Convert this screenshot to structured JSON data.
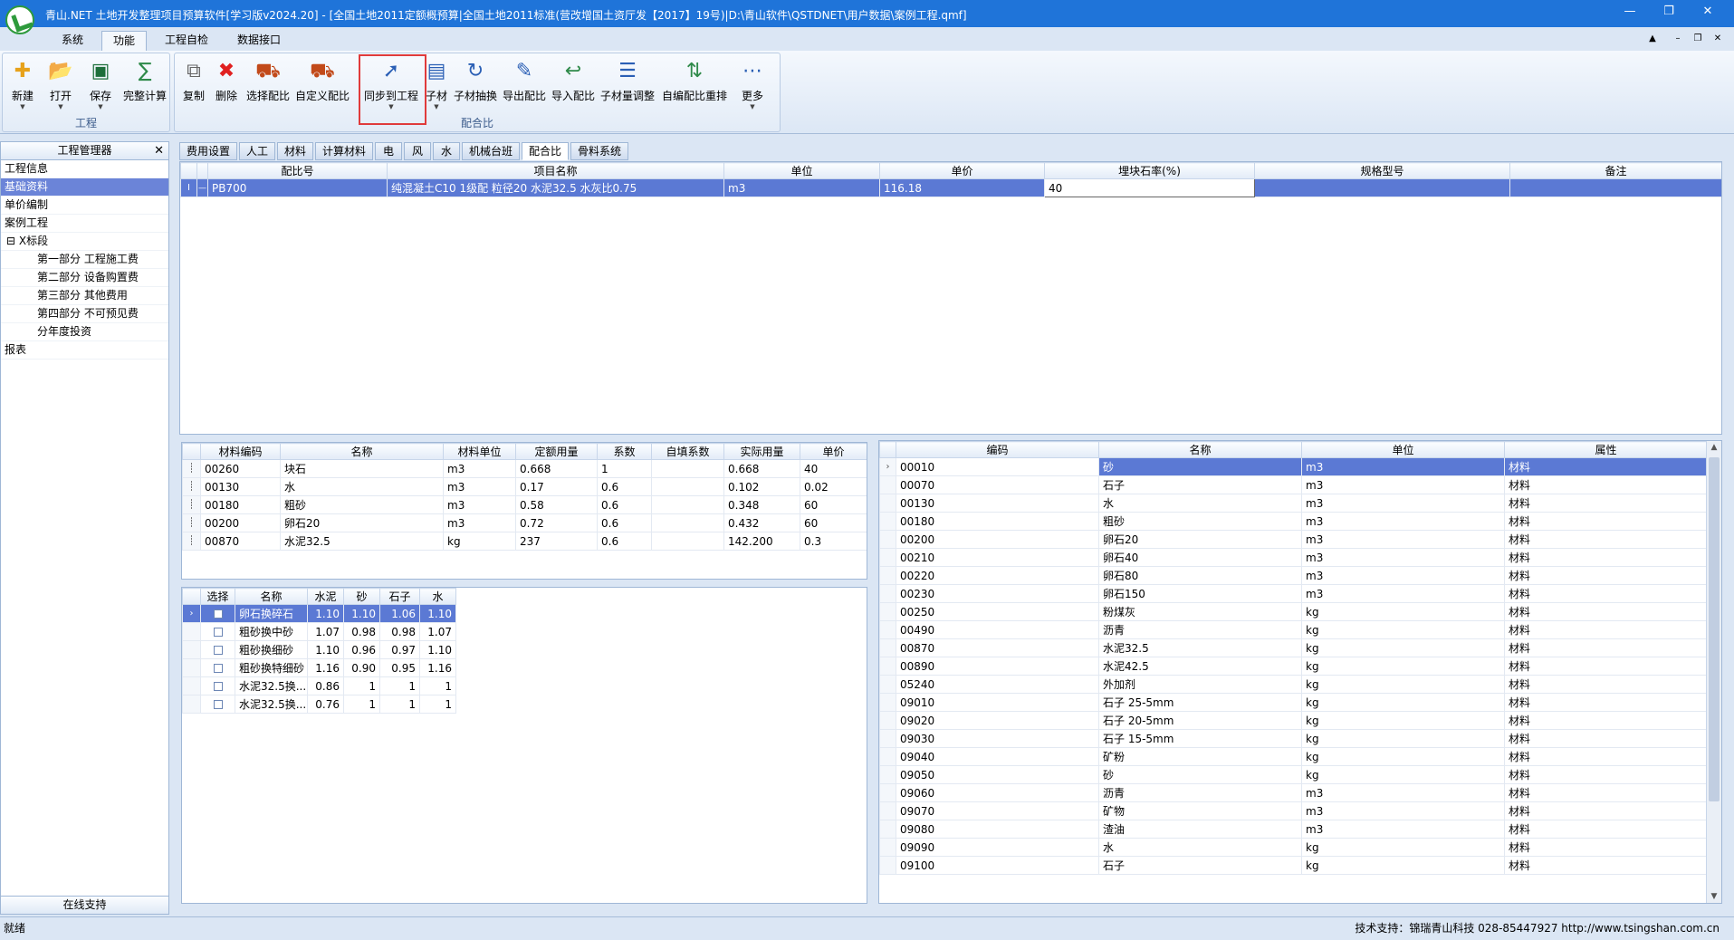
{
  "title": "青山.NET 土地开发整理项目预算软件[学习版v2024.20] - [全国土地2011定额概预算|全国土地2011标准(营改增国土资厅发【2017】19号)|D:\\青山软件\\QSTDNET\\用户数据\\案例工程.qmf]",
  "menu": [
    "系统",
    "功能",
    "工程自检",
    "数据接口"
  ],
  "ribbon": {
    "group1_label": "工程",
    "group2_label": "配合比",
    "buttons1": [
      {
        "label": "新建",
        "icon": "new-icon"
      },
      {
        "label": "打开",
        "icon": "folder-open-icon"
      },
      {
        "label": "保存",
        "icon": "save-icon"
      },
      {
        "label": "完整计算",
        "icon": "calculate-icon"
      }
    ],
    "buttons2": [
      {
        "label": "复制",
        "icon": "copy-icon"
      },
      {
        "label": "删除",
        "icon": "delete-icon"
      },
      {
        "label": "选择配比",
        "icon": "mixer-truck-icon"
      },
      {
        "label": "自定义配比",
        "icon": "mixer-truck-icon"
      },
      {
        "label": "同步到工程",
        "icon": "sync-icon"
      },
      {
        "label": "子材",
        "icon": "submaterial-icon"
      },
      {
        "label": "子材抽换",
        "icon": "swap-icon"
      },
      {
        "label": "导出配比",
        "icon": "export-icon"
      },
      {
        "label": "导入配比",
        "icon": "import-icon"
      },
      {
        "label": "子材量调整",
        "icon": "edit-list-icon"
      },
      {
        "label": "自编配比重排",
        "icon": "reorder-icon"
      },
      {
        "label": "更多",
        "icon": "more-icon"
      }
    ]
  },
  "left_panel": {
    "title": "工程管理器",
    "items": [
      "工程信息",
      "基础资料",
      "单价编制",
      "案例工程",
      "X标段",
      "第一部分 工程施工费",
      "第二部分 设备购置费",
      "第三部分 其他费用",
      "第四部分 不可预见费",
      "分年度投资",
      "报表"
    ],
    "footer": "在线支持"
  },
  "tabs": [
    "费用设置",
    "人工",
    "材料",
    "计算材料",
    "电",
    "风",
    "水",
    "机械台班",
    "配合比",
    "骨料系统"
  ],
  "mix_table": {
    "headers": [
      "配比号",
      "项目名称",
      "单位",
      "单价",
      "埋块石率(%)",
      "规格型号",
      "备注"
    ],
    "rows": [
      [
        "PB700",
        "纯混凝土C10 1级配 粒径20 水泥32.5 水灰比0.75",
        "m3",
        "116.18",
        "40",
        "",
        ""
      ]
    ]
  },
  "material_table": {
    "headers": [
      "材料编码",
      "名称",
      "材料单位",
      "定额用量",
      "系数",
      "自填系数",
      "实际用量",
      "单价"
    ],
    "rows": [
      [
        "00260",
        "块石",
        "m3",
        "0.668",
        "1",
        "",
        "0.668",
        "40"
      ],
      [
        "00130",
        "水",
        "m3",
        "0.17",
        "0.6",
        "",
        "0.102",
        "0.02"
      ],
      [
        "00180",
        "粗砂",
        "m3",
        "0.58",
        "0.6",
        "",
        "0.348",
        "60"
      ],
      [
        "00200",
        "卵石20",
        "m3",
        "0.72",
        "0.6",
        "",
        "0.432",
        "60"
      ],
      [
        "00870",
        "水泥32.5",
        "kg",
        "237",
        "0.6",
        "",
        "142.200",
        "0.3"
      ]
    ]
  },
  "swap_table": {
    "headers": [
      "选择",
      "名称",
      "水泥",
      "砂",
      "石子",
      "水"
    ],
    "rows": [
      [
        "",
        "卵石换碎石",
        "1.10",
        "1.10",
        "1.06",
        "1.10"
      ],
      [
        "",
        "粗砂换中砂",
        "1.07",
        "0.98",
        "0.98",
        "1.07"
      ],
      [
        "",
        "粗砂换细砂",
        "1.10",
        "0.96",
        "0.97",
        "1.10"
      ],
      [
        "",
        "粗砂换特细砂",
        "1.16",
        "0.90",
        "0.95",
        "1.16"
      ],
      [
        "",
        "水泥32.5换...",
        "0.86",
        "1",
        "1",
        "1"
      ],
      [
        "",
        "水泥32.5换...",
        "0.76",
        "1",
        "1",
        "1"
      ]
    ]
  },
  "library_table": {
    "headers": [
      "编码",
      "名称",
      "单位",
      "属性"
    ],
    "rows": [
      [
        "00010",
        "砂",
        "m3",
        "材料"
      ],
      [
        "00070",
        "石子",
        "m3",
        "材料"
      ],
      [
        "00130",
        "水",
        "m3",
        "材料"
      ],
      [
        "00180",
        "粗砂",
        "m3",
        "材料"
      ],
      [
        "00200",
        "卵石20",
        "m3",
        "材料"
      ],
      [
        "00210",
        "卵石40",
        "m3",
        "材料"
      ],
      [
        "00220",
        "卵石80",
        "m3",
        "材料"
      ],
      [
        "00230",
        "卵石150",
        "m3",
        "材料"
      ],
      [
        "00250",
        "粉煤灰",
        "kg",
        "材料"
      ],
      [
        "00490",
        "沥青",
        "kg",
        "材料"
      ],
      [
        "00870",
        "水泥32.5",
        "kg",
        "材料"
      ],
      [
        "00890",
        "水泥42.5",
        "kg",
        "材料"
      ],
      [
        "05240",
        "外加剂",
        "kg",
        "材料"
      ],
      [
        "09010",
        "石子 25-5mm",
        "kg",
        "材料"
      ],
      [
        "09020",
        "石子 20-5mm",
        "kg",
        "材料"
      ],
      [
        "09030",
        "石子 15-5mm",
        "kg",
        "材料"
      ],
      [
        "09040",
        "矿粉",
        "kg",
        "材料"
      ],
      [
        "09050",
        "砂",
        "kg",
        "材料"
      ],
      [
        "09060",
        "沥青",
        "m3",
        "材料"
      ],
      [
        "09070",
        "矿物",
        "m3",
        "材料"
      ],
      [
        "09080",
        "渣油",
        "m3",
        "材料"
      ],
      [
        "09090",
        "水",
        "kg",
        "材料"
      ],
      [
        "09100",
        "石子",
        "kg",
        "材料"
      ]
    ]
  },
  "status": {
    "left": "就绪",
    "right": "技术支持：锦瑞青山科技 028-85447927 http://www.tsingshan.com.cn"
  }
}
